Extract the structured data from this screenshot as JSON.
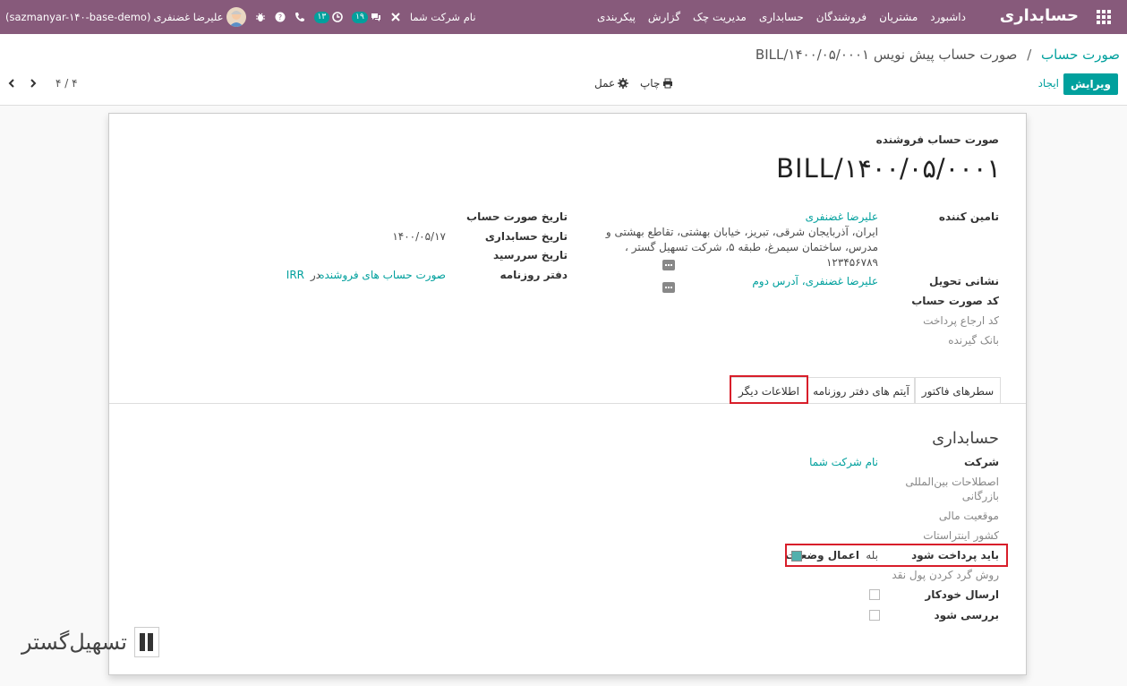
{
  "navbar": {
    "brand": "حسابداری",
    "menu": [
      "داشبورد",
      "مشتریان",
      "فروشندگان",
      "حسابداری",
      "مدیریت چک",
      "گزارش",
      "پیکربندی"
    ],
    "company": "نام شرکت شما",
    "messages_count": "۱۹",
    "activities_count": "۱۳",
    "user": "علیرضا غضنفری",
    "db": "(sazmanyar-۱۴۰-base-demo)"
  },
  "breadcrumb": {
    "parent": "صورت حساب",
    "separator": "/",
    "current": "صورت حساب پیش نویس BILL/۱۴۰۰/۰۵/۰۰۰۱"
  },
  "toolbar": {
    "edit": "ویرایش",
    "create": "ایجاد",
    "print": "چاپ",
    "action": "عمل",
    "pager": "۴ / ۴"
  },
  "header": {
    "type": "صورت حساب فروشنده",
    "number": "BILL/۱۴۰۰/۰۵/۰۰۰۱"
  },
  "left_fields": {
    "vendor_label": "تامین کننده",
    "vendor_name": "علیرضا غضنفری",
    "vendor_address_1": "ایران، آذربایجان شرقی، تبریز، خیابان بهشتی، تقاطع بهشتی و",
    "vendor_address_2": "مدرس، ساختمان سیمرغ، طبقه ۵، شرکت تسهیل گستر ،",
    "vendor_phone": "۱۲۳۴۵۶۷۸۹",
    "delivery_label": "نشانی تحویل",
    "delivery_value": "علیرضا غضنفری، آدرس دوم",
    "bill_ref_label": "کد صورت حساب",
    "payment_ref_label": "کد ارجاع پرداخت",
    "bank_label": "بانک گیرنده"
  },
  "right_fields": {
    "bill_date_label": "تاریخ صورت حساب",
    "accounting_date_label": "تاریخ حسابداری",
    "accounting_date_value": "۱۴۰۰/۰۵/۱۷",
    "due_date_label": "تاریخ سررسید",
    "journal_label": "دفتر روزنامه",
    "journal_value": "صورت حساب های فروشنده",
    "journal_in": "در",
    "currency": "IRR"
  },
  "tabs": {
    "invoice_lines": "سطرهای فاکتور",
    "journal_items": "آیتم های دفتر روزنامه",
    "other_info": "اطلاعات دیگر"
  },
  "accounting": {
    "title": "حسابداری",
    "company_label": "شرکت",
    "company_value": "نام شرکت شما",
    "incoterm_label_1": "اصطلاحات بین‌المللی",
    "incoterm_label_2": "بازرگانی",
    "fiscal_label": "موقعیت مالی",
    "intrastat_label": "کشور اینتراستات",
    "to_pay_label": "باید پرداخت شود",
    "to_pay_value": "بله",
    "apply_status_label": "اعمال وضعیت",
    "rounding_label": "روش گرد کردن پول نقد",
    "auto_send_label": "ارسال خودکار",
    "to_check_label": "بررسی شود"
  },
  "colors": {
    "navbar": "#875a7b",
    "primary": "#00a09d",
    "highlight": "#d81e2a"
  }
}
